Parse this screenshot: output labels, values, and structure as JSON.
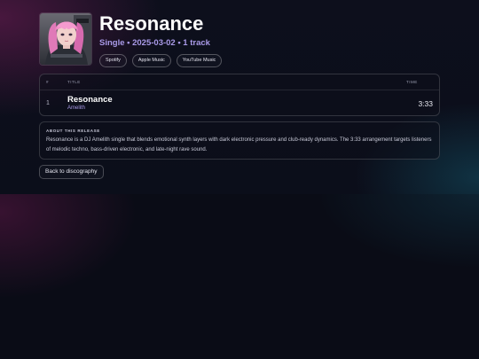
{
  "release": {
    "title": "Resonance",
    "meta": "Single • 2025-03-02 • 1 track",
    "cover_image": "album-cover-pink-hair-character"
  },
  "links": [
    {
      "label": "Spotify"
    },
    {
      "label": "Apple Music"
    },
    {
      "label": "YouTube Music"
    }
  ],
  "tracklist": {
    "headers": {
      "num": "#",
      "title": "TITLE",
      "time": "TIME"
    },
    "rows": [
      {
        "num": "1",
        "title": "Resonance",
        "artist": "Amelith",
        "time": "3:33"
      }
    ]
  },
  "about": {
    "heading": "ABOUT THIS RELEASE",
    "text": "Resonance is a DJ Amelith single that blends emotional synth layers with dark electronic pressure and club-ready dynamics. The 3:33 arrangement targets listeners of melodic techno, bass-driven electronic, and late-night rave sound."
  },
  "back_label": "Back to discography",
  "colors": {
    "accent": "#a99ae8",
    "background": "#0a0d18",
    "title": "#ffffff"
  }
}
